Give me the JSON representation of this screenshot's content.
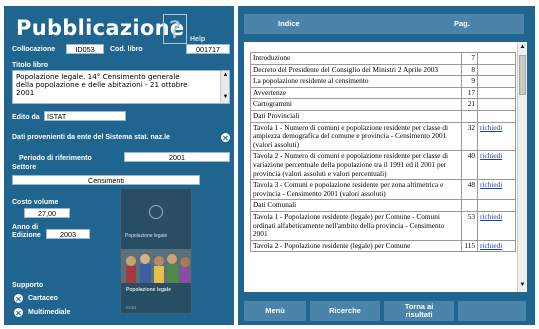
{
  "header": {
    "title": "Pubblicazione",
    "help_label": "Help"
  },
  "collocazione": {
    "label": "Collocazione",
    "value": "ID053"
  },
  "cod_libro": {
    "label": "Cod. libro",
    "value": "001717"
  },
  "titolo": {
    "label": "Titolo libro",
    "lines": [
      "Popolazione legale. 14° Censimento generale",
      "della popolazione e delle abitazioni - 21 ottobre",
      "2001"
    ]
  },
  "edito": {
    "label": "Edito da",
    "value": "ISTAT"
  },
  "sistan": {
    "label": "Dati provenienti da ente del Sistema stat. naz.le"
  },
  "periodo": {
    "label": "Periodo di riferimento",
    "value": "2001"
  },
  "settore": {
    "label": "Settore",
    "value": "Censimenti"
  },
  "costo": {
    "label": "Costo volume",
    "value": "27,00"
  },
  "anno": {
    "label_line1": "Anno di",
    "label_line2": "Edizione",
    "value": "2003"
  },
  "supporto": {
    "label": "Supporto",
    "options": [
      "Cartaceo",
      "Multimediale"
    ]
  },
  "cover": {
    "title": "Popolazione legale",
    "subtitle": "Popolazione legale",
    "footer": "ISTAT"
  },
  "index_header": {
    "indice": "Indice",
    "pag": "Pag."
  },
  "index_rows": [
    {
      "text": "Introduzione",
      "page": "7",
      "link": ""
    },
    {
      "text": "Decreto del Presidente del Consiglio dei Ministri 2 Aprile 2003",
      "page": "8",
      "link": ""
    },
    {
      "text": "La popolazione residente al censimento",
      "page": "9",
      "link": ""
    },
    {
      "text": "Avvertenze",
      "page": "17",
      "link": ""
    },
    {
      "text": "Cartogrammi",
      "page": "21",
      "link": ""
    },
    {
      "text": "Dati Provinciali",
      "page": "",
      "link": ""
    },
    {
      "text": "Tavola 1 - Numero di comuni e popolazione residente per classe di ampiezza demografica del comune e provincia - Censimento 2001 (valori assoluti)",
      "page": "32",
      "link": "richiedi"
    },
    {
      "text": "Tavola 2 - Numero di comuni e popolazione residente per classe di variazione percentuale della popolazione tra il 1991 ed il 2001 per provincia (valori assoluti e valori percentuali)",
      "page": "40",
      "link": "richiedi"
    },
    {
      "text": "Tavola 3 - Comuni e popolazione residente per zona altimetrica e provincia - Censimento 2001 (valori assoluti)",
      "page": "48",
      "link": "richiedi"
    },
    {
      "text": "Dati Comunali",
      "page": "",
      "link": ""
    },
    {
      "text": "Tavola 1 - Popolazione residente (legale) per Comune - Comuni ordinati alfabeticamente nell'ambito della provincia - Censimento 2001",
      "page": "53",
      "link": "richiedi"
    },
    {
      "text": "Tavola 2 - Popolazione residente (legale) per Comune",
      "page": "115",
      "link": "richiedi"
    }
  ],
  "bottom_nav": {
    "menu": "Menù",
    "ricerche": "Ricerche",
    "torna_line1": "Torna ai",
    "torna_line2": "risultati"
  },
  "colors": {
    "panel": "#1f6590",
    "bar": "#4b84ab",
    "link": "#1a3fb0"
  }
}
